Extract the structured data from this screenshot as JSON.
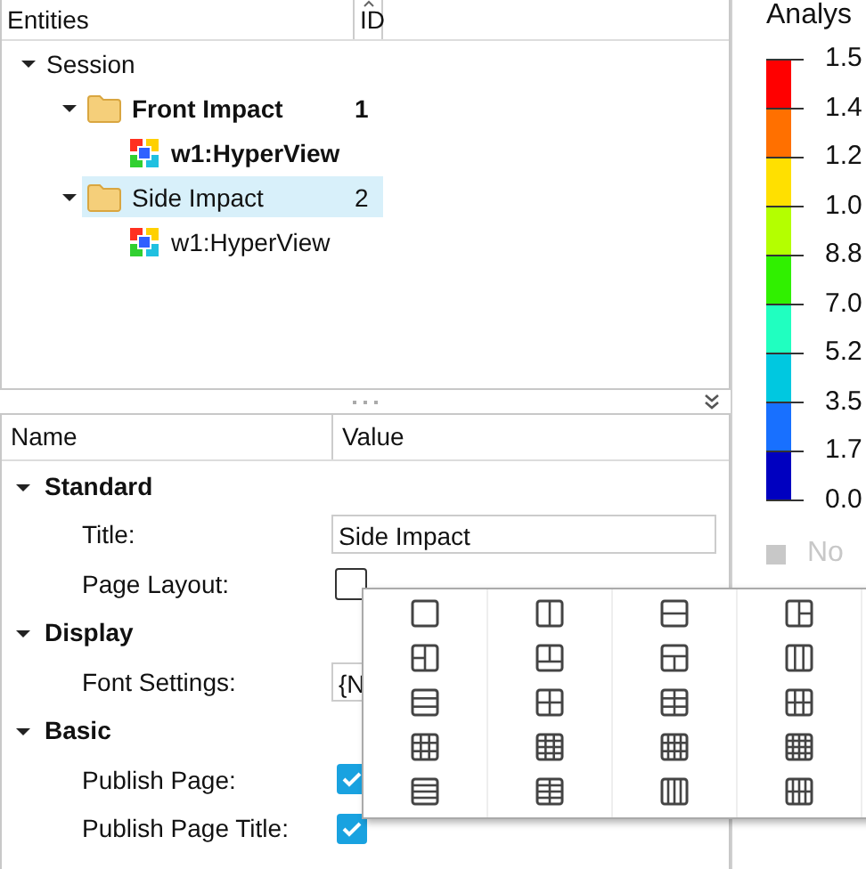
{
  "tree": {
    "columns": [
      "Entities",
      "ID"
    ],
    "items": [
      {
        "label": "Session",
        "expanded": true,
        "selected": false,
        "bold": false,
        "children": [
          {
            "label": "Front Impact",
            "id": "1",
            "kind": "folder",
            "expanded": true,
            "selected": false,
            "bold": true,
            "children": [
              {
                "label": "w1:HyperView",
                "kind": "view",
                "selected": false,
                "bold": true
              }
            ]
          },
          {
            "label": "Side Impact",
            "id": "2",
            "kind": "folder",
            "expanded": true,
            "selected": true,
            "bold": false,
            "children": [
              {
                "label": "w1:HyperView",
                "kind": "view",
                "selected": false,
                "bold": false
              }
            ]
          }
        ]
      }
    ]
  },
  "properties": {
    "columns": [
      "Name",
      "Value"
    ],
    "groups": [
      {
        "label": "Standard",
        "expanded": true,
        "rows": [
          {
            "label": "Title:",
            "kind": "text",
            "value": "Side Impact"
          },
          {
            "label": "Page Layout:",
            "kind": "layout",
            "expanded": true
          }
        ]
      },
      {
        "label": "Display",
        "expanded": true,
        "rows": [
          {
            "label": "Font Settings:",
            "kind": "text",
            "value": "{N"
          }
        ]
      },
      {
        "label": "Basic",
        "expanded": true,
        "rows": [
          {
            "label": "Publish Page:",
            "kind": "checkbox",
            "checked": true
          },
          {
            "label": "Publish Page Title:",
            "kind": "checkbox",
            "checked": true
          }
        ]
      }
    ]
  },
  "legend": {
    "title": "Analys",
    "bands": [
      {
        "color": "#ff0000"
      },
      {
        "color": "#ff7000"
      },
      {
        "color": "#ffe000"
      },
      {
        "color": "#b4ff00"
      },
      {
        "color": "#30f000"
      },
      {
        "color": "#20ffc0"
      },
      {
        "color": "#00c8e0"
      },
      {
        "color": "#1870ff"
      },
      {
        "color": "#0000c0"
      }
    ],
    "labels": [
      "1.5",
      "1.4",
      "1.2",
      "1.0",
      "8.8",
      "7.0",
      "5.2",
      "3.5",
      "1.7",
      "0.0"
    ],
    "no_result": "No"
  }
}
